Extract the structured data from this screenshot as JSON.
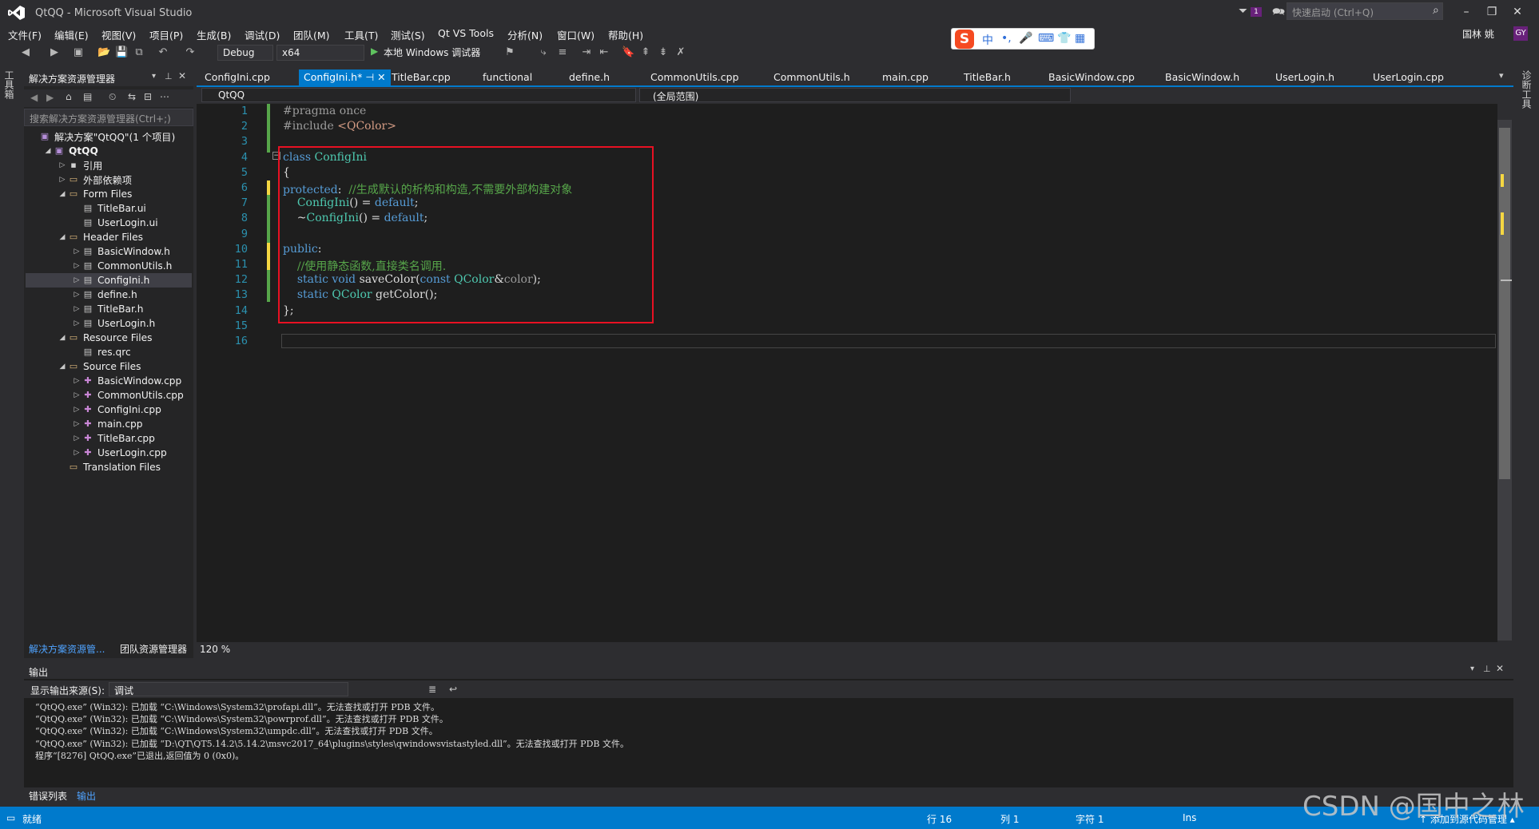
{
  "window": {
    "title": "QtQQ - Microsoft Visual Studio",
    "quick_launch_placeholder": "快速启动 (Ctrl+Q)",
    "notify_count": "1",
    "user_name": "国林 姚",
    "user_initials": "GY"
  },
  "menu": [
    "文件(F)",
    "编辑(E)",
    "视图(V)",
    "项目(P)",
    "生成(B)",
    "调试(D)",
    "团队(M)",
    "工具(T)",
    "测试(S)",
    "Qt VS Tools",
    "分析(N)",
    "窗口(W)",
    "帮助(H)"
  ],
  "toolbar": {
    "config": "Debug",
    "platform": "x64",
    "start_debug": "本地 Windows 调试器"
  },
  "ime": {
    "lang": "中",
    "logo": "S"
  },
  "side_tabs": {
    "toolbox": "工具箱",
    "diagnostics": "诊断工具"
  },
  "solution_explorer": {
    "title": "解决方案资源管理器",
    "search_placeholder": "搜索解决方案资源管理器(Ctrl+;)",
    "items": [
      {
        "label": "解决方案\"QtQQ\"(1 个项目)",
        "indent": 0,
        "icon": "sol",
        "tw": ""
      },
      {
        "label": "QtQQ",
        "indent": 1,
        "icon": "sol",
        "tw": "◢",
        "bold": true
      },
      {
        "label": "引用",
        "indent": 2,
        "icon": "ref",
        "tw": "▷"
      },
      {
        "label": "外部依赖项",
        "indent": 2,
        "icon": "folder",
        "tw": "▷"
      },
      {
        "label": "Form Files",
        "indent": 2,
        "icon": "folder",
        "tw": "◢"
      },
      {
        "label": "TitleBar.ui",
        "indent": 3,
        "icon": "file",
        "tw": ""
      },
      {
        "label": "UserLogin.ui",
        "indent": 3,
        "icon": "file",
        "tw": ""
      },
      {
        "label": "Header Files",
        "indent": 2,
        "icon": "folder",
        "tw": "◢"
      },
      {
        "label": "BasicWindow.h",
        "indent": 3,
        "icon": "file",
        "tw": "▷"
      },
      {
        "label": "CommonUtils.h",
        "indent": 3,
        "icon": "file",
        "tw": "▷"
      },
      {
        "label": "ConfigIni.h",
        "indent": 3,
        "icon": "file",
        "tw": "▷",
        "selected": true
      },
      {
        "label": "define.h",
        "indent": 3,
        "icon": "file",
        "tw": "▷"
      },
      {
        "label": "TitleBar.h",
        "indent": 3,
        "icon": "file",
        "tw": "▷"
      },
      {
        "label": "UserLogin.h",
        "indent": 3,
        "icon": "file",
        "tw": "▷"
      },
      {
        "label": "Resource Files",
        "indent": 2,
        "icon": "folder",
        "tw": "◢"
      },
      {
        "label": "res.qrc",
        "indent": 3,
        "icon": "file",
        "tw": ""
      },
      {
        "label": "Source Files",
        "indent": 2,
        "icon": "folder",
        "tw": "◢"
      },
      {
        "label": "BasicWindow.cpp",
        "indent": 3,
        "icon": "cpp",
        "tw": "▷"
      },
      {
        "label": "CommonUtils.cpp",
        "indent": 3,
        "icon": "cpp",
        "tw": "▷"
      },
      {
        "label": "ConfigIni.cpp",
        "indent": 3,
        "icon": "cpp",
        "tw": "▷"
      },
      {
        "label": "main.cpp",
        "indent": 3,
        "icon": "cpp",
        "tw": "▷"
      },
      {
        "label": "TitleBar.cpp",
        "indent": 3,
        "icon": "cpp",
        "tw": "▷"
      },
      {
        "label": "UserLogin.cpp",
        "indent": 3,
        "icon": "cpp",
        "tw": "▷"
      },
      {
        "label": "Translation Files",
        "indent": 2,
        "icon": "folder",
        "tw": ""
      }
    ],
    "bottom_tab_solution": "解决方案资源管...",
    "bottom_tab_team": "团队资源管理器"
  },
  "editor": {
    "tabs": [
      {
        "label": "ConfigIni.cpp"
      },
      {
        "label": "ConfigIni.h*",
        "active": true
      },
      {
        "label": "TitleBar.cpp"
      },
      {
        "label": "functional"
      },
      {
        "label": "define.h"
      },
      {
        "label": "CommonUtils.cpp"
      },
      {
        "label": "CommonUtils.h"
      },
      {
        "label": "main.cpp"
      },
      {
        "label": "TitleBar.h"
      },
      {
        "label": "BasicWindow.cpp"
      },
      {
        "label": "BasicWindow.h"
      },
      {
        "label": "UserLogin.h"
      },
      {
        "label": "UserLogin.cpp"
      }
    ],
    "nav_project": "QtQQ",
    "nav_scope": "(全局范围)",
    "zoom": "120 %",
    "lines": [
      {
        "n": "1",
        "html": "<span class=\"pp\">#pragma once</span>"
      },
      {
        "n": "2",
        "html": "<span class=\"pp\">#include </span><span class=\"st\">&lt;QColor&gt;</span>"
      },
      {
        "n": "3",
        "html": ""
      },
      {
        "n": "4",
        "html": "<span class=\"kw\">class</span> <span class=\"ty\">ConfigIni</span>"
      },
      {
        "n": "5",
        "html": "{"
      },
      {
        "n": "6",
        "html": "<span class=\"kw\">protected</span>:  <span class=\"cm\">//生成默认的析构和构造,不需要外部构建对象</span>"
      },
      {
        "n": "7",
        "html": "    <span class=\"ty\">ConfigIni</span>() = <span class=\"kw\">default</span>;"
      },
      {
        "n": "8",
        "html": "    ~<span class=\"ty\">ConfigIni</span>() = <span class=\"kw\">default</span>;"
      },
      {
        "n": "9",
        "html": ""
      },
      {
        "n": "10",
        "html": "<span class=\"kw\">public</span>:"
      },
      {
        "n": "11",
        "html": "    <span class=\"cm\">//使用静态函数,直接类名调用.</span>"
      },
      {
        "n": "12",
        "html": "    <span class=\"kw\">static void</span> saveColor(<span class=\"kw\">const</span> <span class=\"ty\">QColor</span>&amp;<span class=\"par\">color</span>);"
      },
      {
        "n": "13",
        "html": "    <span class=\"kw\">static</span> <span class=\"ty\">QColor</span> getColor();"
      },
      {
        "n": "14",
        "html": "};"
      },
      {
        "n": "15",
        "html": ""
      },
      {
        "n": "16",
        "html": ""
      }
    ]
  },
  "output": {
    "title": "输出",
    "source_label": "显示输出来源(S):",
    "source_value": "调试",
    "lines": [
      "“QtQQ.exe” (Win32): 已加载 “C:\\Windows\\System32\\profapi.dll”。无法查找或打开 PDB 文件。",
      "“QtQQ.exe” (Win32): 已加载 “C:\\Windows\\System32\\powrprof.dll”。无法查找或打开 PDB 文件。",
      "“QtQQ.exe” (Win32): 已加载 “C:\\Windows\\System32\\umpdc.dll”。无法查找或打开 PDB 文件。",
      "“QtQQ.exe” (Win32): 已加载 “D:\\QT\\QT5.14.2\\5.14.2\\msvc2017_64\\plugins\\styles\\qwindowsvistastyled.dll”。无法查找或打开 PDB 文件。",
      "程序“[8276] QtQQ.exe”已退出,返回值为 0 (0x0)。"
    ],
    "tab_errors": "错误列表",
    "tab_output": "输出"
  },
  "statusbar": {
    "ready": "就绪",
    "line": "行 16",
    "col": "列 1",
    "char": "字符 1",
    "mode": "Ins",
    "source_control": "↑ 添加到源代码管理 ▴"
  },
  "watermark": "CSDN @国中之林",
  "colors": {
    "accent": "#007acc",
    "highlight_box": "#e81123",
    "editor_bg": "#1e1e1e",
    "chrome_bg": "#2d2d30"
  }
}
